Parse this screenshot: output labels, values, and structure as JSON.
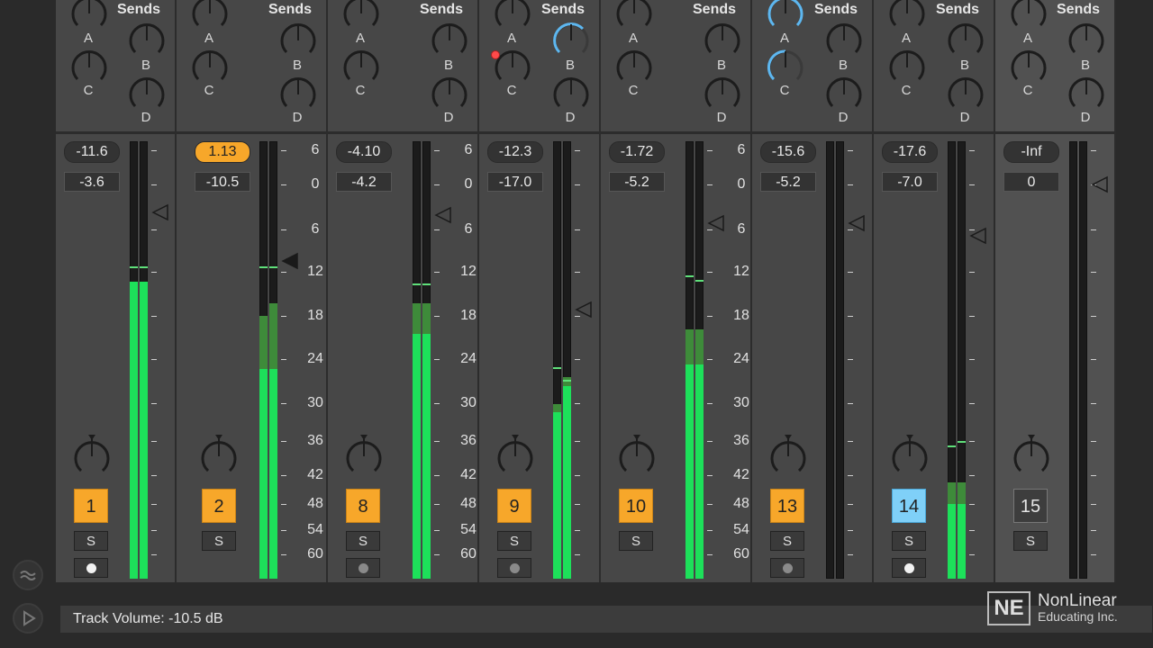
{
  "sends_label": "Sends",
  "send_letters": [
    "A",
    "B",
    "C",
    "D"
  ],
  "accent_color": "#f7a72a",
  "active_knob_color": "#5db7f0",
  "meter_color": "#1de05a",
  "tracks": [
    {
      "number": "1",
      "volume": "-11.6",
      "peak": "-3.6",
      "solo": "S",
      "btn": "orange",
      "arm": "clock",
      "volume_active": false
    },
    {
      "number": "2",
      "volume": "1.13",
      "peak": "-10.5",
      "solo": "S",
      "btn": "orange",
      "arm": "none",
      "volume_active": true
    },
    {
      "number": "8",
      "volume": "-4.10",
      "peak": "-4.2",
      "solo": "S",
      "btn": "orange",
      "arm": "grey"
    },
    {
      "number": "9",
      "volume": "-12.3",
      "peak": "-17.0",
      "solo": "S",
      "btn": "orange",
      "arm": "grey"
    },
    {
      "number": "10",
      "volume": "-1.72",
      "peak": "-5.2",
      "solo": "S",
      "btn": "orange",
      "arm": "none"
    },
    {
      "number": "13",
      "volume": "-15.6",
      "peak": "-5.2",
      "solo": "S",
      "btn": "orange",
      "arm": "grey"
    },
    {
      "number": "14",
      "volume": "-17.6",
      "peak": "-7.0",
      "solo": "S",
      "btn": "blue",
      "arm": "white"
    },
    {
      "number": "15",
      "volume": "-Inf",
      "peak": "0",
      "solo": "S",
      "btn": "grey",
      "arm": "none"
    }
  ],
  "db_scale": [
    "6",
    "0",
    "6",
    "12",
    "18",
    "24",
    "30",
    "36",
    "42",
    "48",
    "54",
    "60"
  ],
  "status": {
    "text": "Track Volume: -10.5 dB"
  },
  "logo": {
    "mark": "NE",
    "line1": "NonLinear",
    "line2": "Educating Inc."
  }
}
